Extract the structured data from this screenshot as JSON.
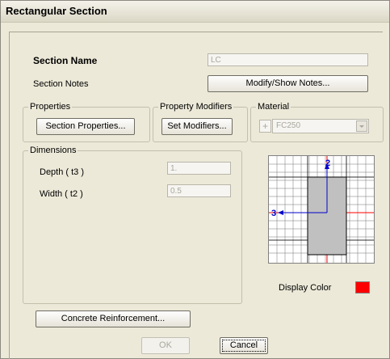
{
  "window": {
    "title": "Rectangular Section"
  },
  "section": {
    "name_label": "Section Name",
    "name_value": "LC",
    "notes_label": "Section Notes",
    "notes_button": "Modify/Show Notes..."
  },
  "properties": {
    "legend": "Properties",
    "button": "Section Properties..."
  },
  "modifiers": {
    "legend": "Property Modifiers",
    "button": "Set Modifiers..."
  },
  "material": {
    "legend": "Material",
    "add_symbol": "+",
    "selected": "FC250"
  },
  "dimensions": {
    "legend": "Dimensions",
    "depth_label": "Depth ( t3 )",
    "depth_value": "1.",
    "width_label": "Width ( t2 )",
    "width_value": "0.5"
  },
  "preview": {
    "axis_2": "2",
    "axis_3": "3",
    "section_color": "#c0c0c0"
  },
  "display_color": {
    "label": "Display Color",
    "value": "#ff0000"
  },
  "buttons": {
    "reinforcement": "Concrete Reinforcement...",
    "ok": "OK",
    "cancel": "Cancel"
  }
}
